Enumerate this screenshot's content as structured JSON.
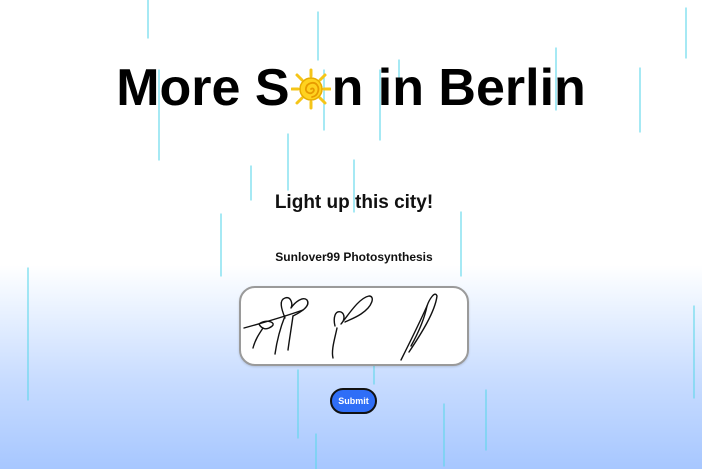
{
  "page": {
    "title_before": "More S",
    "title_after": "n in Berlin",
    "subtitle": "Light up this city!",
    "username": "Sunlover99 Photosynthesis"
  },
  "form": {
    "submit_label": "Submit"
  },
  "colors": {
    "sun": "#f5c518",
    "submit": "#2f6ef7",
    "rain": "#55d6e8",
    "sky_bottom": "#a7c7ff"
  },
  "icons": {
    "title_o": "sun-icon"
  }
}
